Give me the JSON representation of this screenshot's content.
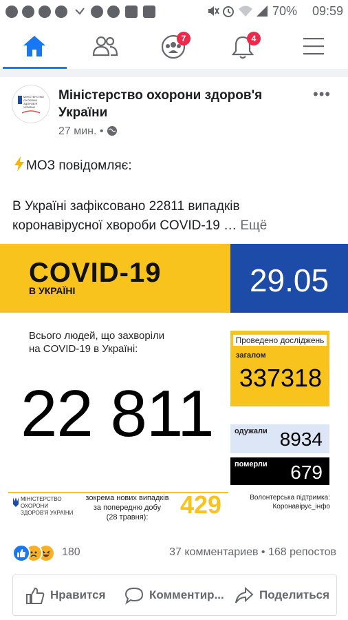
{
  "status_bar": {
    "battery": "70%",
    "time": "09:59",
    "left_icons": [
      "facebook-icon",
      "facebook-icon",
      "messenger-icon",
      "search-app-icon",
      "missed-call-icon",
      "messenger-icon",
      "viber-icon",
      "image-icon",
      "flipboard-icon"
    ],
    "right_icons": [
      "mute-icon",
      "alarm-icon",
      "wifi-icon",
      "signal-icon"
    ]
  },
  "nav": {
    "items": [
      {
        "name": "home",
        "icon": "home-icon",
        "active": true
      },
      {
        "name": "friends",
        "icon": "friends-icon"
      },
      {
        "name": "groups",
        "icon": "groups-icon",
        "badge": "7"
      },
      {
        "name": "notifications",
        "icon": "bell-icon",
        "badge": "4"
      },
      {
        "name": "menu",
        "icon": "menu-icon"
      }
    ],
    "accent": "#1877f2"
  },
  "post": {
    "page_name": "Міністерство охорони здоров'я України",
    "time": "27 мин.",
    "privacy_icon": "globe-icon",
    "line1": "МОЗ повідомляє:",
    "line2": "В Україні зафіксовано 22811 випадків",
    "line3": "коронавірусної хвороби COVID-19 …",
    "see_more": "Ещё",
    "avatar_text": "МІНІСТЕРСТВО ОХОРОНИ ЗДОРОВ'Я УКРАЇНИ"
  },
  "infographic": {
    "title": "COVID-19",
    "subtitle": "В УКРАЇНІ",
    "date": "29.05",
    "total_label_1": "Всього людей, що захворіли",
    "total_label_2": "на COVID-19 в Україні:",
    "total": "22 811",
    "tests_title": "Проведено досліджень",
    "tests_sub": "загалом",
    "tests": "337318",
    "recovered_label": "одужали",
    "recovered": "8934",
    "deaths_label": "померли",
    "deaths": "679",
    "ministry": "МІНІСТЕРСТВО ОХОРОНИ ЗДОРОВ'Я УКРАЇНИ",
    "new_label_1": "зокрема нових випадків",
    "new_label_2": "за попередню добу",
    "new_label_3": "(28 травня):",
    "new_cases": "429",
    "volunteer_1": "Волонтерська підтримка:",
    "volunteer_2": "Коронавірус_інфо",
    "colors": {
      "yellow": "#f7c31c",
      "blue": "#1d4ba8"
    }
  },
  "footer": {
    "reactions_count": "180",
    "comments_shares": "37 комментариев • 168 репостов",
    "like": "Нравится",
    "comment": "Комментир...",
    "share": "Поделиться"
  }
}
